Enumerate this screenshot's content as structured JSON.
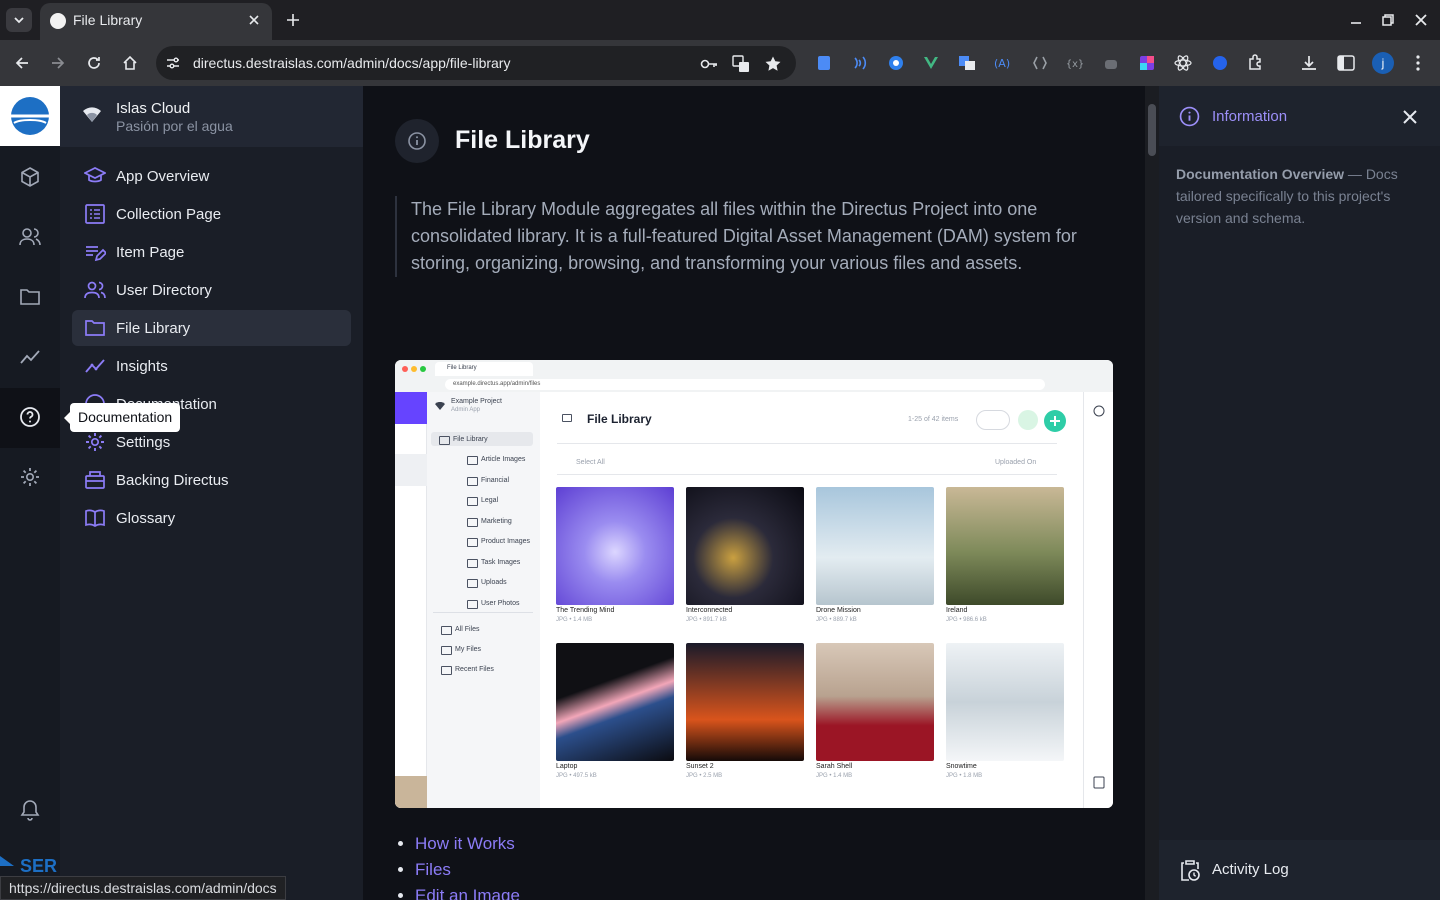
{
  "browser": {
    "tab_title": "File Library",
    "url": "directus.destraislas.com/admin/docs/app/file-library",
    "profile_initial": "j",
    "status_url": "https://directus.destraislas.com/admin/docs"
  },
  "project": {
    "name": "Islas Cloud",
    "subtitle": "Pasión por el agua"
  },
  "tooltip": "Documentation",
  "nav_items": [
    {
      "label": "App Overview",
      "icon": "graduation-cap-icon"
    },
    {
      "label": "Collection Page",
      "icon": "list-alt-icon"
    },
    {
      "label": "Item Page",
      "icon": "edit-note-icon"
    },
    {
      "label": "User Directory",
      "icon": "people-icon"
    },
    {
      "label": "File Library",
      "icon": "folder-icon",
      "active": true
    },
    {
      "label": "Insights",
      "icon": "insights-icon"
    },
    {
      "label": "Documentation",
      "icon": "help-icon"
    },
    {
      "label": "Settings",
      "icon": "gear-icon"
    },
    {
      "label": "Backing Directus",
      "icon": "backer-icon"
    },
    {
      "label": "Glossary",
      "icon": "book-icon"
    }
  ],
  "page": {
    "title": "File Library",
    "intro": "The File Library Module aggregates all files within the Directus Project into one consolidated library. It is a full-featured Digital Asset Management (DAM) system for storing, organizing, browsing, and transforming your various files and assets.",
    "links": [
      "How it Works",
      "Files",
      "Edit an Image"
    ]
  },
  "sidebar": {
    "info_title": "Information",
    "info_heading": "Documentation Overview",
    "info_text": " — Docs tailored specifically to this project's version and schema.",
    "activity_label": "Activity Log"
  },
  "screenshot": {
    "tab": "File Library",
    "url": "example.directus.app/admin/files",
    "project_name": "Example Project",
    "project_sub": "Admin App",
    "title": "File Library",
    "count": "1-25 of 42 items",
    "select_all": "Select All",
    "sort": "Uploaded On",
    "folder_root": "File Library",
    "folders": [
      "Article Images",
      "Financial",
      "Legal",
      "Marketing",
      "Product Images",
      "Task Images",
      "Uploads",
      "User Photos"
    ],
    "sections": [
      "All Files",
      "My Files",
      "Recent Files"
    ],
    "files": [
      {
        "name": "The Trending Mind",
        "meta": "JPG • 1.4 MB"
      },
      {
        "name": "Interconnected",
        "meta": "JPG • 891.7 kB"
      },
      {
        "name": "Drone Mission",
        "meta": "JPG • 889.7 kB"
      },
      {
        "name": "Ireland",
        "meta": "JPG • 986.6 kB"
      },
      {
        "name": "Laptop",
        "meta": "JPG • 497.5 kB"
      },
      {
        "name": "Sunset 2",
        "meta": "JPG • 2.5 MB"
      },
      {
        "name": "Sarah Shell",
        "meta": "JPG • 1.4 MB"
      },
      {
        "name": "Snowtime",
        "meta": "JPG • 1.8 MB"
      }
    ]
  },
  "colors": {
    "accent": "#6644ff",
    "link": "#8c7cf7",
    "background": "#0f1117"
  }
}
